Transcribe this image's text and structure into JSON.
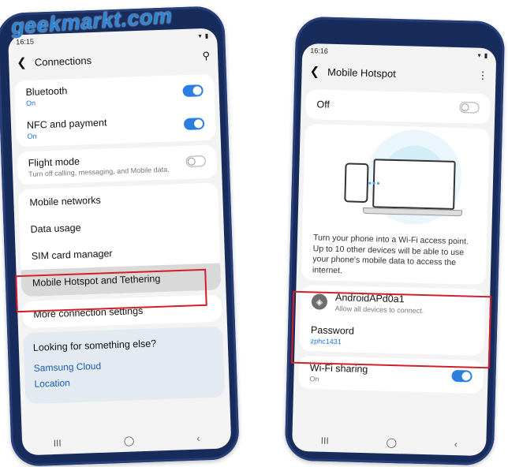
{
  "watermark": "geekmarkt.com",
  "left_phone": {
    "time": "16:15",
    "status_icons": "▾ ▮",
    "title": "Connections",
    "items_top": [
      {
        "title": "Bluetooth",
        "sub": "On"
      },
      {
        "title": "NFC and payment",
        "sub": "On"
      }
    ],
    "flight": {
      "title": "Flight mode",
      "sub": "Turn off calling, messaging, and Mobile data."
    },
    "menu": [
      "Mobile networks",
      "Data usage",
      "SIM card manager",
      "Mobile Hotspot and Tethering"
    ],
    "more": "More connection settings",
    "help": {
      "title": "Looking for something else?",
      "links": [
        "Samsung Cloud",
        "Location"
      ]
    },
    "nav": {
      "recent": "III",
      "home": "◯",
      "back": "‹"
    }
  },
  "right_phone": {
    "time": "16:16",
    "status_icons": "▾ ▮",
    "title": "Mobile Hotspot",
    "state": "Off",
    "description": "Turn your phone into a Wi-Fi access point. Up to 10 other devices will be able to use your phone's mobile data to access the internet.",
    "network": {
      "name": "AndroidAPd0a1",
      "sub": "Allow all devices to connect."
    },
    "password": {
      "title": "Password",
      "value": "zphc1431"
    },
    "wifi_sharing": {
      "title": "Wi-Fi sharing",
      "sub": "On"
    },
    "nav": {
      "recent": "III",
      "home": "◯",
      "back": "‹"
    }
  },
  "colors": {
    "accent": "#2b7fdf",
    "highlight": "#d01f2a",
    "phone_frame": "#182c5c"
  }
}
